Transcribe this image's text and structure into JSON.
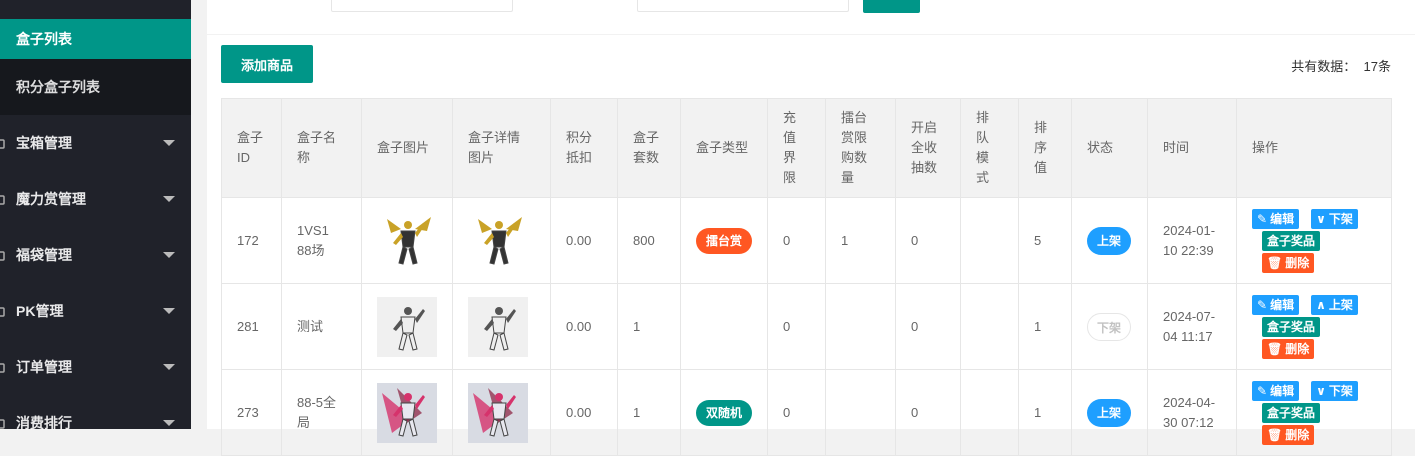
{
  "sidebar": {
    "sub_items": [
      "盒子列表",
      "积分盒子列表"
    ],
    "menus": [
      "宝箱管理",
      "魔力赏管理",
      "福袋管理",
      "PK管理",
      "订单管理",
      "消费排行"
    ]
  },
  "toolbar": {
    "add_label": "添加商品",
    "total_label": "共有数据：",
    "total_count": "17条"
  },
  "table": {
    "headers": [
      [
        "盒子",
        "ID"
      ],
      [
        "盒子名",
        "称"
      ],
      [
        "盒子图片"
      ],
      [
        "盒子详情",
        "图片"
      ],
      [
        "积分",
        "抵扣"
      ],
      [
        "盒子",
        "套数"
      ],
      [
        "盒子类型"
      ],
      [
        "充",
        "值",
        "界",
        "限"
      ],
      [
        "擂台",
        "赏限",
        "购数",
        "量"
      ],
      [
        "开启",
        "全收",
        "抽数"
      ],
      [
        "排",
        "队",
        "模",
        "式"
      ],
      [
        "排",
        "序",
        "值"
      ],
      [
        "状态"
      ],
      [
        "时间"
      ],
      [
        "操作"
      ]
    ],
    "rows": [
      {
        "id": "172",
        "name": [
          "1VS1",
          "88场"
        ],
        "points": "0.00",
        "sets": "800",
        "type": "擂台赏",
        "type_color": "#ff5722",
        "recharge": "0",
        "limit": "1",
        "full": "0",
        "queue": "",
        "sort": "5",
        "status": "上架",
        "status_on": true,
        "time": [
          "2024-01-",
          "10 22:39"
        ],
        "toggle": "下架",
        "image": "gold"
      },
      {
        "id": "281",
        "name": [
          "测试"
        ],
        "points": "0.00",
        "sets": "1",
        "type": "",
        "type_color": "",
        "recharge": "0",
        "limit": "",
        "full": "0",
        "queue": "",
        "sort": "1",
        "status": "下架",
        "status_on": false,
        "time": [
          "2024-07-",
          "04 11:17"
        ],
        "toggle": "上架",
        "image": "white"
      },
      {
        "id": "273",
        "name": [
          "88-5全",
          "局"
        ],
        "points": "0.00",
        "sets": "1",
        "type": "双随机",
        "type_color": "#009688",
        "recharge": "0",
        "limit": "",
        "full": "0",
        "queue": "",
        "sort": "1",
        "status": "上架",
        "status_on": true,
        "time": [
          "2024-04-",
          "30 07:12"
        ],
        "toggle": "下架",
        "image": "pink"
      }
    ],
    "op_labels": {
      "edit": "编辑",
      "prize": "盒子奖品",
      "delete": "删除"
    }
  },
  "colors": {
    "primary": "#009688",
    "blue": "#1e9fff",
    "orange": "#ff5722",
    "sidebar": "#20222a"
  }
}
